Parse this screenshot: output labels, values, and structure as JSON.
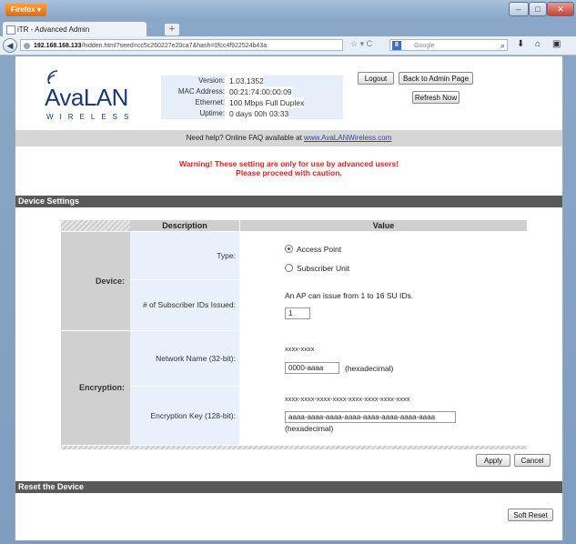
{
  "browser": {
    "menu_button": "Firefox",
    "tab_title": "iTR - Advanced Admin",
    "new_tab": "+",
    "url_host": "192.168.168.133",
    "url_rest": "/hidden.html?seed=cc5c260227e20ca7&hash=0fcc4f922524b43a",
    "search_engine": "Google"
  },
  "header": {
    "logo_main": "AvaLAN",
    "logo_sub": "WIRELESS",
    "info": [
      {
        "label": "Version:",
        "value": "1.03.1352"
      },
      {
        "label": "MAC Address:",
        "value": "00:21:74:00:00:09"
      },
      {
        "label": "Ethernet:",
        "value": "100 Mbps Full Duplex"
      },
      {
        "label": "Uptime:",
        "value": "0 days 00h 03:33"
      }
    ],
    "logout": "Logout",
    "back_admin": "Back to Admin Page",
    "refresh": "Refresh Now"
  },
  "help": {
    "text": "Need help?  Online FAQ available at",
    "link": "www.AvaLANWireless.com"
  },
  "warning": {
    "line1": "Warning! These setting are only for use by advanced users!",
    "line2": "Please proceed with caution."
  },
  "device_settings": {
    "title": "Device Settings",
    "col_description": "Description",
    "col_value": "Value",
    "device_group": "Device:",
    "type_label": "Type:",
    "type_options": [
      "Access Point",
      "Subscriber Unit"
    ],
    "type_selected": "Access Point",
    "subscriber_label": "# of Subscriber IDs Issued:",
    "subscriber_hint": "An AP can issue from 1 to 16 SU IDs.",
    "subscriber_value": "1",
    "encryption_group": "Encryption:",
    "network_label": "Network Name (32-bit):",
    "network_format": "xxxx-xxxx",
    "network_value": "0000-aaaa",
    "network_suffix": "(hexadecimal)",
    "key_label": "Encryption Key (128-bit):",
    "key_format": "xxxx-xxxx-xxxx-xxxx-xxxx-xxxx-xxxx-xxxx",
    "key_value": "aaaa-aaaa-aaaa-aaaa-aaaa-aaaa-aaaa-aaaa",
    "key_suffix": "(hexadecimal)",
    "apply": "Apply",
    "cancel": "Cancel"
  },
  "reset": {
    "title": "Reset the Device",
    "soft_reset": "Soft Reset"
  }
}
